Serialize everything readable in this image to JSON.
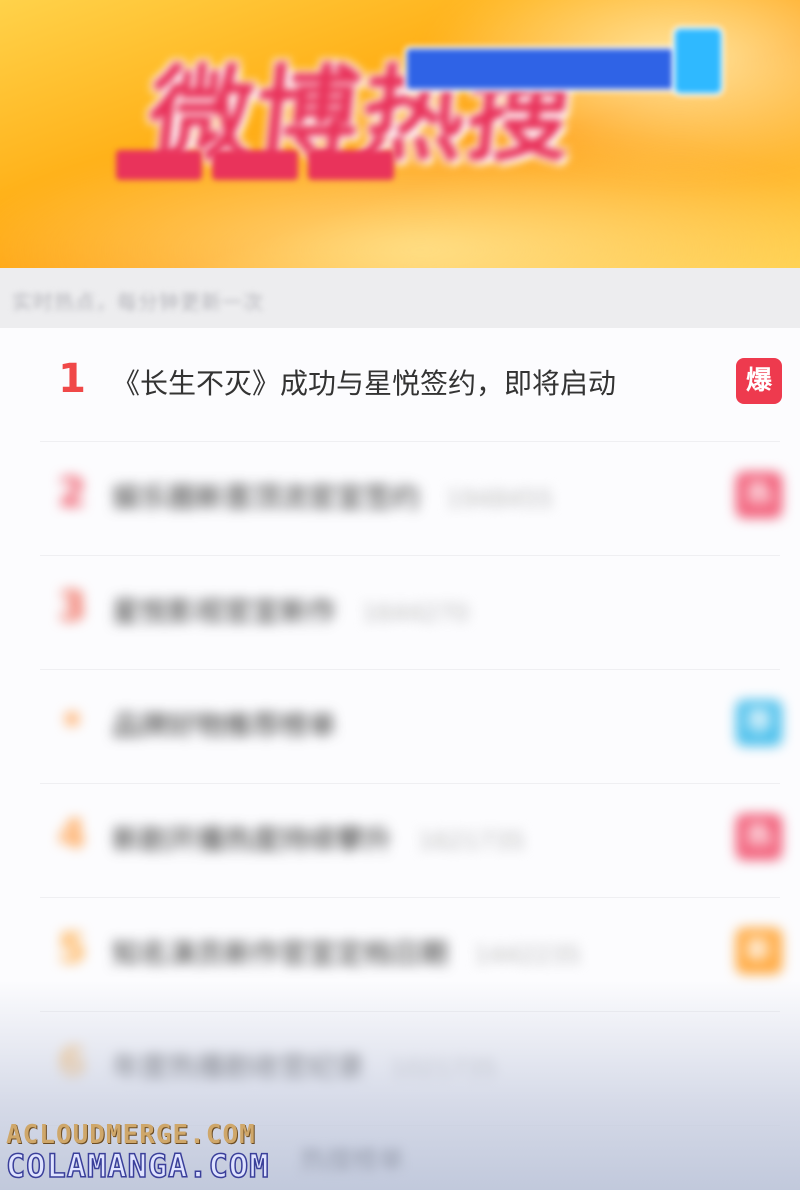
{
  "banner": {
    "logo_text": "微博热搜",
    "accent_color": "#e9335b",
    "pill_color": "#2f63e6"
  },
  "subheader": {
    "text": "实时热点，每分钟更新一次"
  },
  "list": {
    "items": [
      {
        "rank": "1",
        "title": "《长生不灭》成功与星悦签约，即将启动",
        "heat": "",
        "badge": "爆",
        "badge_color": "#ee3a4e",
        "rank_color": "#f04848",
        "blurred": false
      },
      {
        "rank": "2",
        "title": "娱乐圈新晋顶流官宣签约",
        "heat": "1948455",
        "badge": "热",
        "badge_color": "#f25d78",
        "rank_color": "#f05a6a",
        "blurred": true
      },
      {
        "rank": "3",
        "title": "星悦影视官宣新作",
        "heat": "1644270",
        "badge": "",
        "badge_color": "",
        "rank_color": "#f06a5a",
        "blurred": true
      },
      {
        "rank": "•",
        "title": "品牌好物推荐榜单",
        "heat": "",
        "badge": "荐",
        "badge_color": "#4cc0ec",
        "rank_color": "#ffb070",
        "blurred": true
      },
      {
        "rank": "4",
        "title": "新剧开播热度持续攀升",
        "heat": "1621735",
        "badge": "热",
        "badge_color": "#f25d78",
        "rank_color": "#ffa658",
        "blurred": true
      },
      {
        "rank": "5",
        "title": "知名演员新作官宣定档日期",
        "heat": "1442235",
        "badge": "新",
        "badge_color": "#ffa83e",
        "rank_color": "#ffb052",
        "blurred": true
      },
      {
        "rank": "6",
        "title": "年度热播剧收官纪录",
        "heat": "1021735",
        "badge": "",
        "badge_color": "",
        "rank_color": "#ffbe68",
        "blurred": true
      }
    ],
    "ghost_text": "热搜榜单"
  },
  "watermark": {
    "line1": "ACLOUDMERGE.COM",
    "line2": "COLAMANGA.COM"
  }
}
